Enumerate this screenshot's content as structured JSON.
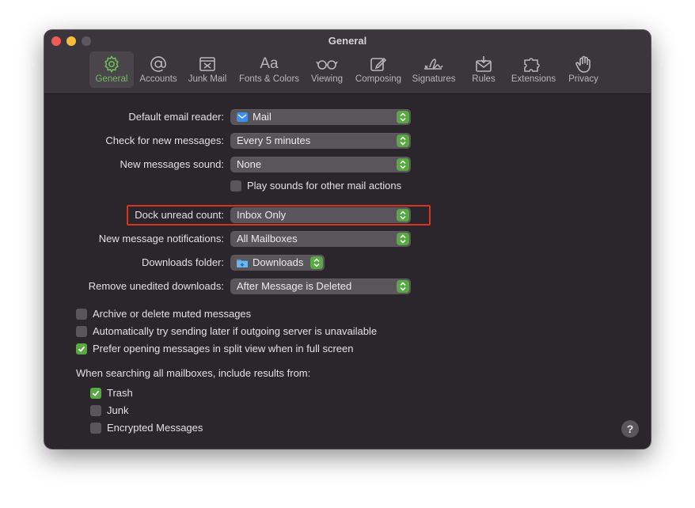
{
  "window": {
    "title": "General"
  },
  "toolbar": {
    "items": [
      {
        "label": "General",
        "icon": "gear-icon"
      },
      {
        "label": "Accounts",
        "icon": "at-sign-icon"
      },
      {
        "label": "Junk Mail",
        "icon": "junk-tray-icon"
      },
      {
        "label": "Fonts & Colors",
        "icon": "font-aa-icon"
      },
      {
        "label": "Viewing",
        "icon": "glasses-icon"
      },
      {
        "label": "Composing",
        "icon": "compose-icon"
      },
      {
        "label": "Signatures",
        "icon": "signature-icon"
      },
      {
        "label": "Rules",
        "icon": "envelope-rules-icon"
      },
      {
        "label": "Extensions",
        "icon": "puzzle-icon"
      },
      {
        "label": "Privacy",
        "icon": "hand-icon"
      }
    ],
    "active": "General"
  },
  "settings": {
    "default_reader": {
      "label": "Default email reader:",
      "value": "Mail"
    },
    "check_new": {
      "label": "Check for new messages:",
      "value": "Every 5 minutes"
    },
    "new_sound": {
      "label": "New messages sound:",
      "value": "None"
    },
    "play_sounds": {
      "label": "Play sounds for other mail actions",
      "checked": false
    },
    "dock_unread": {
      "label": "Dock unread count:",
      "value": "Inbox Only"
    },
    "notifications": {
      "label": "New message notifications:",
      "value": "All Mailboxes"
    },
    "downloads_folder": {
      "label": "Downloads folder:",
      "value": "Downloads"
    },
    "remove_downloads": {
      "label": "Remove unedited downloads:",
      "value": "After Message is Deleted"
    }
  },
  "options": {
    "archive_muted": {
      "label": "Archive or delete muted messages",
      "checked": false
    },
    "auto_send_later": {
      "label": "Automatically try sending later if outgoing server is unavailable",
      "checked": false
    },
    "split_view": {
      "label": "Prefer opening messages in split view when in full screen",
      "checked": true
    }
  },
  "search": {
    "heading": "When searching all mailboxes, include results from:",
    "trash": {
      "label": "Trash",
      "checked": true
    },
    "junk": {
      "label": "Junk",
      "checked": false
    },
    "encrypted": {
      "label": "Encrypted Messages",
      "checked": false
    }
  },
  "help": {
    "label": "?"
  },
  "colors": {
    "accent": "#5aa845",
    "window_bg": "#2b262b",
    "highlight": "#d63420"
  }
}
